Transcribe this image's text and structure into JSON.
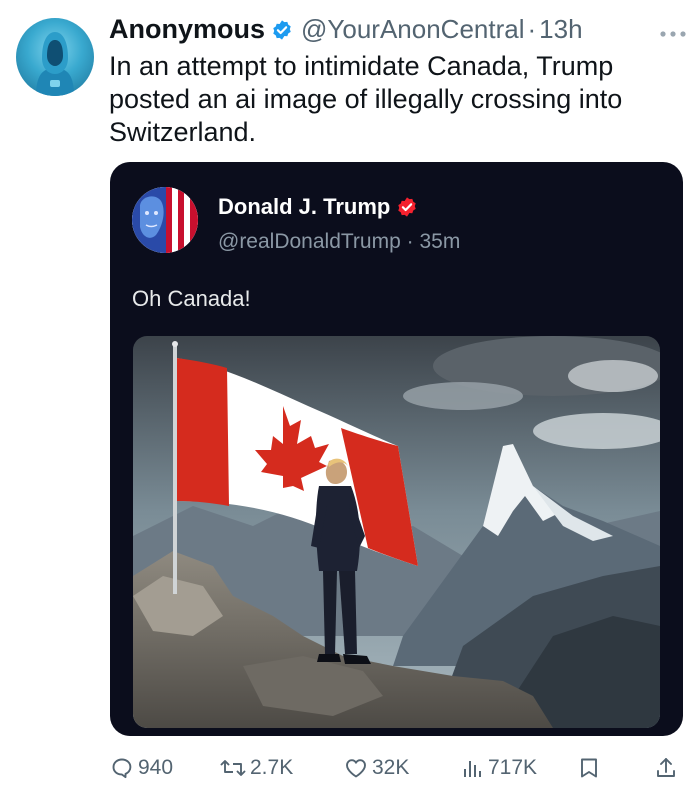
{
  "tweet": {
    "author_name": "Anonymous",
    "handle": "@YourAnonCentral",
    "separator": "·",
    "time": "13h",
    "text": "In an attempt to intimidate Canada, Trump posted an ai image of illegally crossing into Switzerland."
  },
  "quoted": {
    "author_name": "Donald J. Trump",
    "handle": "@realDonaldTrump",
    "separator": "·",
    "time": "35m",
    "text": "Oh Canada!"
  },
  "actions": {
    "replies": "940",
    "reposts": "2.7K",
    "likes": "32K",
    "views": "717K"
  },
  "colors": {
    "verified_blue": "#1d9bf0",
    "verified_red": "#f4212e",
    "card_bg": "#0b0d1c",
    "muted": "#536471"
  },
  "icons": [
    "verified-badge-icon",
    "more-options-icon",
    "reply-icon",
    "repost-icon",
    "like-icon",
    "views-icon",
    "bookmark-icon",
    "share-icon"
  ]
}
